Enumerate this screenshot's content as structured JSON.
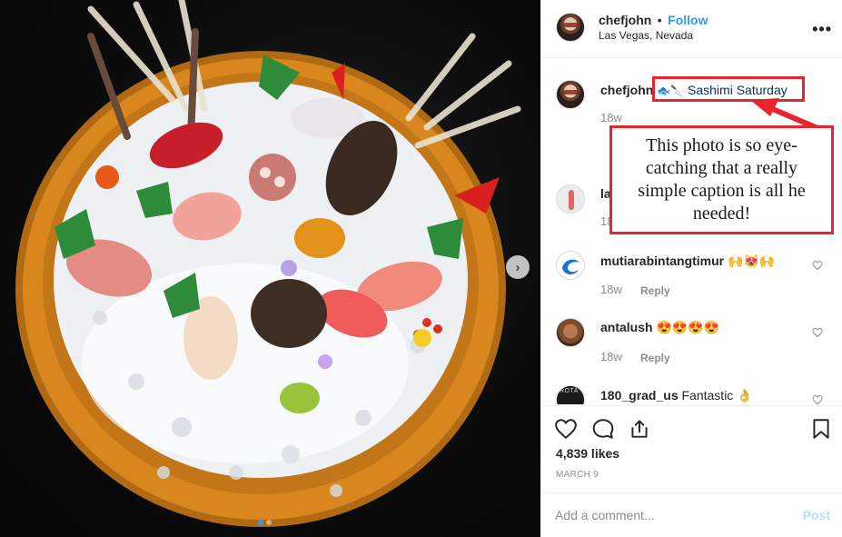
{
  "post": {
    "username": "chefjohn",
    "separator": "•",
    "follow_label": "Follow",
    "location": "Las Vegas, Nevada",
    "more_label": "•••"
  },
  "caption": {
    "username": "chefjohn",
    "emoji": "🐟🔪",
    "hashtag": "Sashimi Saturday",
    "time": "18w"
  },
  "comments": [
    {
      "username": "la",
      "text": "",
      "time": "18",
      "reply": ""
    },
    {
      "username": "mutiarabintangtimur",
      "text": "🙌😻🙌",
      "time": "18w",
      "reply": "Reply"
    },
    {
      "username": "antalush",
      "text": "😍😍😍😍",
      "time": "18w",
      "reply": "Reply"
    },
    {
      "username": "180_grad_us",
      "text": "Fantastic 👌",
      "time": "",
      "reply": ""
    }
  ],
  "engagement": {
    "likes": "4,839 likes",
    "date": "MARCH 9"
  },
  "comment_box": {
    "placeholder": "Add a comment...",
    "post_label": "Post"
  },
  "annotation": {
    "note": "This photo is so eye-catching that a really simple caption is all he needed!",
    "color": "#e8242c"
  },
  "carousel": {
    "next_label": "›",
    "slides": 2,
    "active": 1
  },
  "colors": {
    "link": "#3897f0",
    "hashtag": "#003569",
    "muted": "#8e8e8e",
    "post_disabled": "#b2dffc"
  }
}
